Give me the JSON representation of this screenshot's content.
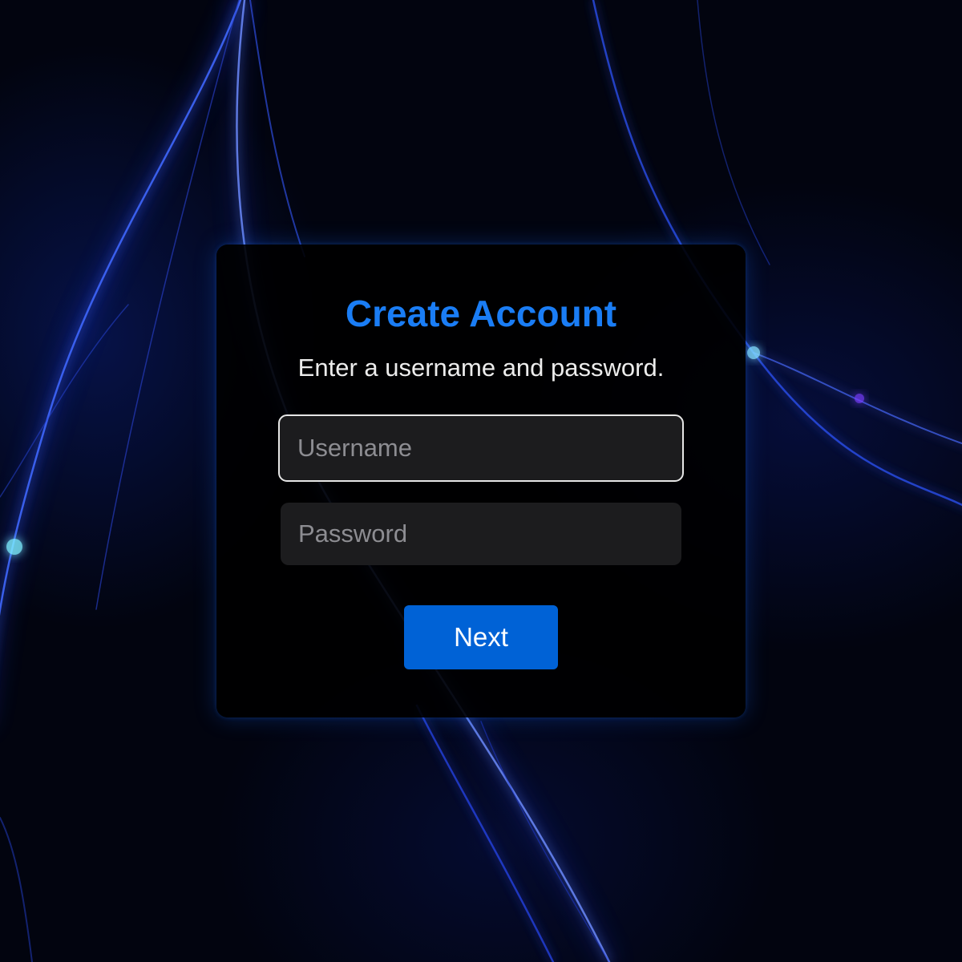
{
  "form": {
    "title": "Create Account",
    "subtitle": "Enter a username and password.",
    "username_placeholder": "Username",
    "username_value": "",
    "password_placeholder": "Password",
    "password_value": "",
    "next_label": "Next"
  },
  "colors": {
    "accent": "#1a7df5",
    "button": "#0062d6",
    "field_background": "#1c1c1e",
    "card_background": "#000000",
    "page_background": "#02040f"
  }
}
